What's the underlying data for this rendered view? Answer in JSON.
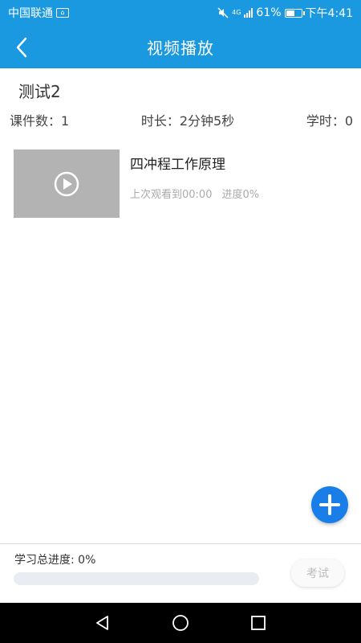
{
  "status_bar": {
    "carrier": "中国联通",
    "battery": "61%",
    "battery_level": 0.61,
    "time": "下午4:41",
    "network": "4G"
  },
  "header": {
    "title": "视频播放",
    "back_icon": "chevron-left-icon"
  },
  "course": {
    "title": "测试2",
    "lesson_count": "课件数：1",
    "duration": "时长：2分钟5秒",
    "hours": "学时：0"
  },
  "lessons": [
    {
      "title": "四冲程工作原理",
      "last_watched": "上次观看到00:00",
      "progress": "进度0%"
    }
  ],
  "bottom": {
    "total_progress_label": "学习总进度: 0%",
    "total_progress_value": 0,
    "exam_button": "考试"
  },
  "colors": {
    "primary": "#1a98e0",
    "fab": "#1a7ee8"
  }
}
